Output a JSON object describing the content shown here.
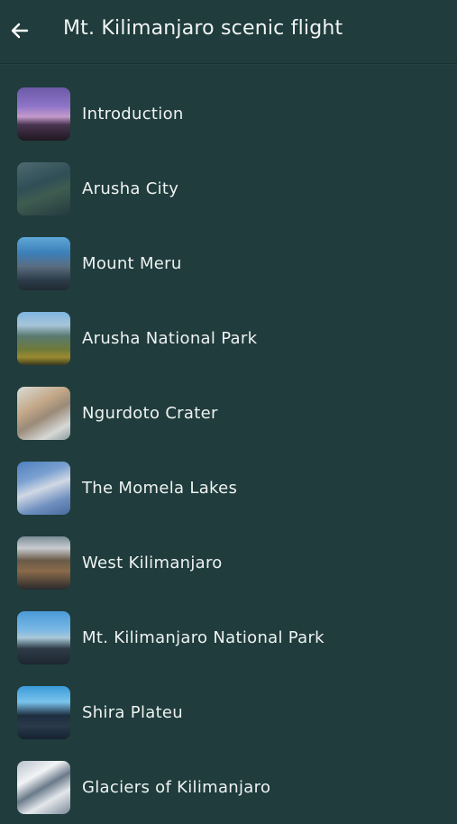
{
  "header": {
    "title": "Mt. Kilimanjaro scenic flight",
    "back_icon": "arrow-left-icon"
  },
  "items": [
    {
      "label": "Introduction"
    },
    {
      "label": "Arusha City"
    },
    {
      "label": "Mount Meru"
    },
    {
      "label": "Arusha National Park"
    },
    {
      "label": "Ngurdoto Crater"
    },
    {
      "label": "The Momela Lakes"
    },
    {
      "label": "West Kilimanjaro"
    },
    {
      "label": "Mt. Kilimanjaro National Park"
    },
    {
      "label": "Shira Plateu"
    },
    {
      "label": "Glaciers of Kilimanjaro"
    }
  ]
}
